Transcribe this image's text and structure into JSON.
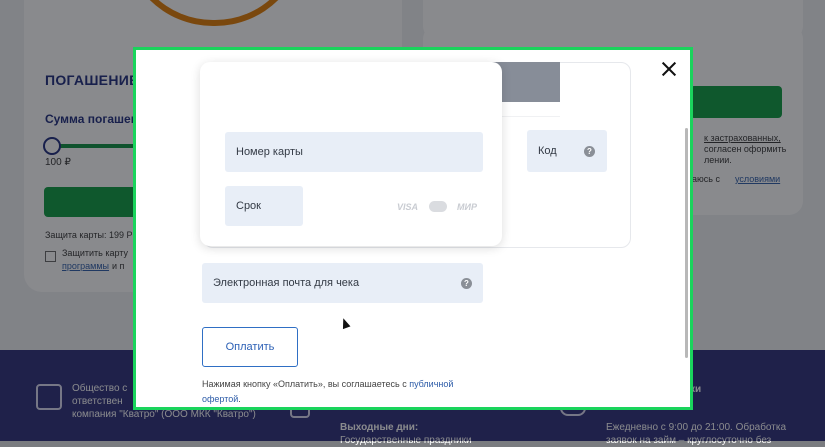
{
  "background": {
    "left_card": {
      "title": "ПОГАШЕНИЕ",
      "sum_label": "Сумма погашен",
      "amount": "100 ₽",
      "card_protection": "Защита карты: 199 Р",
      "protect_checkbox_label": "Защитить карту",
      "programs_link": "программы",
      "and_text": "и п"
    },
    "right_card": {
      "line1": "к застрахованных,",
      "line2": "согласен оформить",
      "line3": "лении.",
      "line4": "аюсь с",
      "conditions_link": "условиями"
    },
    "footer": {
      "company_line1": "Общество с",
      "company_line2": "ответствен",
      "company_line3": "компания \"Кватро\" (ООО МКК \"Кватро\")",
      "weekend_label": "Выходные дни:",
      "holidays": "Государственные праздники",
      "contacts_heading": "ки",
      "schedule_line1": "Ежедневно с 9:00 до 21:00. Обработка",
      "schedule_line2": "заявок на займ – круглосуточно без"
    }
  },
  "modal": {
    "card_form": {
      "card_number_placeholder": "Номер карты",
      "expiry_placeholder": "Срок",
      "cvv_placeholder": "Код",
      "brands": [
        "VISA",
        "МИР"
      ]
    },
    "email_placeholder": "Электронная почта для чека",
    "pay_button": "Оплатить",
    "legal_text": "Нажимая кнопку «Оплатить», вы соглашаетесь с ",
    "legal_link_part1": "публичной",
    "legal_link_part2": "офертой",
    "legal_tail": "."
  },
  "colors": {
    "modal_border": "#1ad45c",
    "accent_green": "#0b9a3f",
    "footer_bg": "#2b2c78",
    "link_blue": "#2d5ca8"
  }
}
